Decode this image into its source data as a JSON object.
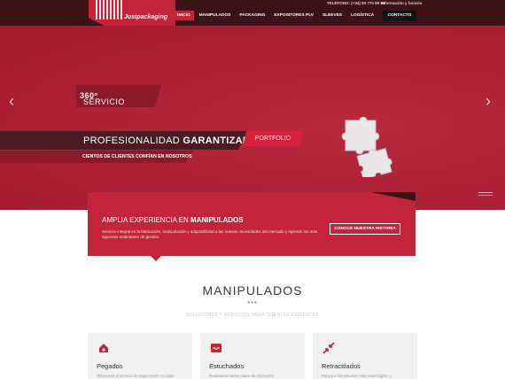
{
  "header": {
    "brand": "Justpackaging",
    "phone": "TELÉFONO: (+34) 93 770 89 00",
    "info": "Información y horario",
    "nav": [
      "INICIO",
      "MANIPULADOS",
      "PACKAGING",
      "EXPOSITORES PLV",
      "SLEEVES",
      "LOGÍSTICA",
      "CALIDAD"
    ],
    "contact": "CONTACTO"
  },
  "hero": {
    "badge_light": "SERVICIO",
    "badge_bold": "360º",
    "headline_light": "PROFESIONALIDAD",
    "headline_bold": "GARANTIZADA",
    "portfolio": "PORTFOLIO",
    "clients": "CIENTOS DE CLIENTES CONFÍAN EN NOSOTROS",
    "prev_icon": "chevron-left-icon",
    "next_icon": "chevron-right-icon"
  },
  "info": {
    "title_light": "AMPLIA EXPERIENCIA EN",
    "title_bold": "MANIPULADOS",
    "desc": "Servicio integral en la fabricación, manipulación y adaptabilidad a las nuevas necesidades del mercado y rigiendo los más rigurosos estándares de gestión.",
    "button": "CONOCE NUESTRA HISTORIA"
  },
  "section": {
    "title": "MANIPULADOS",
    "dots": "•••",
    "subtitle": "SOLUCIONES Y SERVICIOS PARA CLIENTES EXIGENTES",
    "cards": [
      {
        "title": "Pegados",
        "text": "Ofrecemos el servicio de pegar estrés en cajas",
        "icon": "home-arrow-icon"
      },
      {
        "title": "Estuchados",
        "text": "Realizamos varios pasos de elementos",
        "icon": "inbox-icon"
      },
      {
        "title": "Retractilados",
        "text": "Para que los estuches sean más frágiles y",
        "icon": "compress-arrows-icon"
      }
    ]
  },
  "colors": {
    "brand_red": "#c4243a",
    "dark": "#3a1217",
    "hero_red": "#b31b32"
  }
}
